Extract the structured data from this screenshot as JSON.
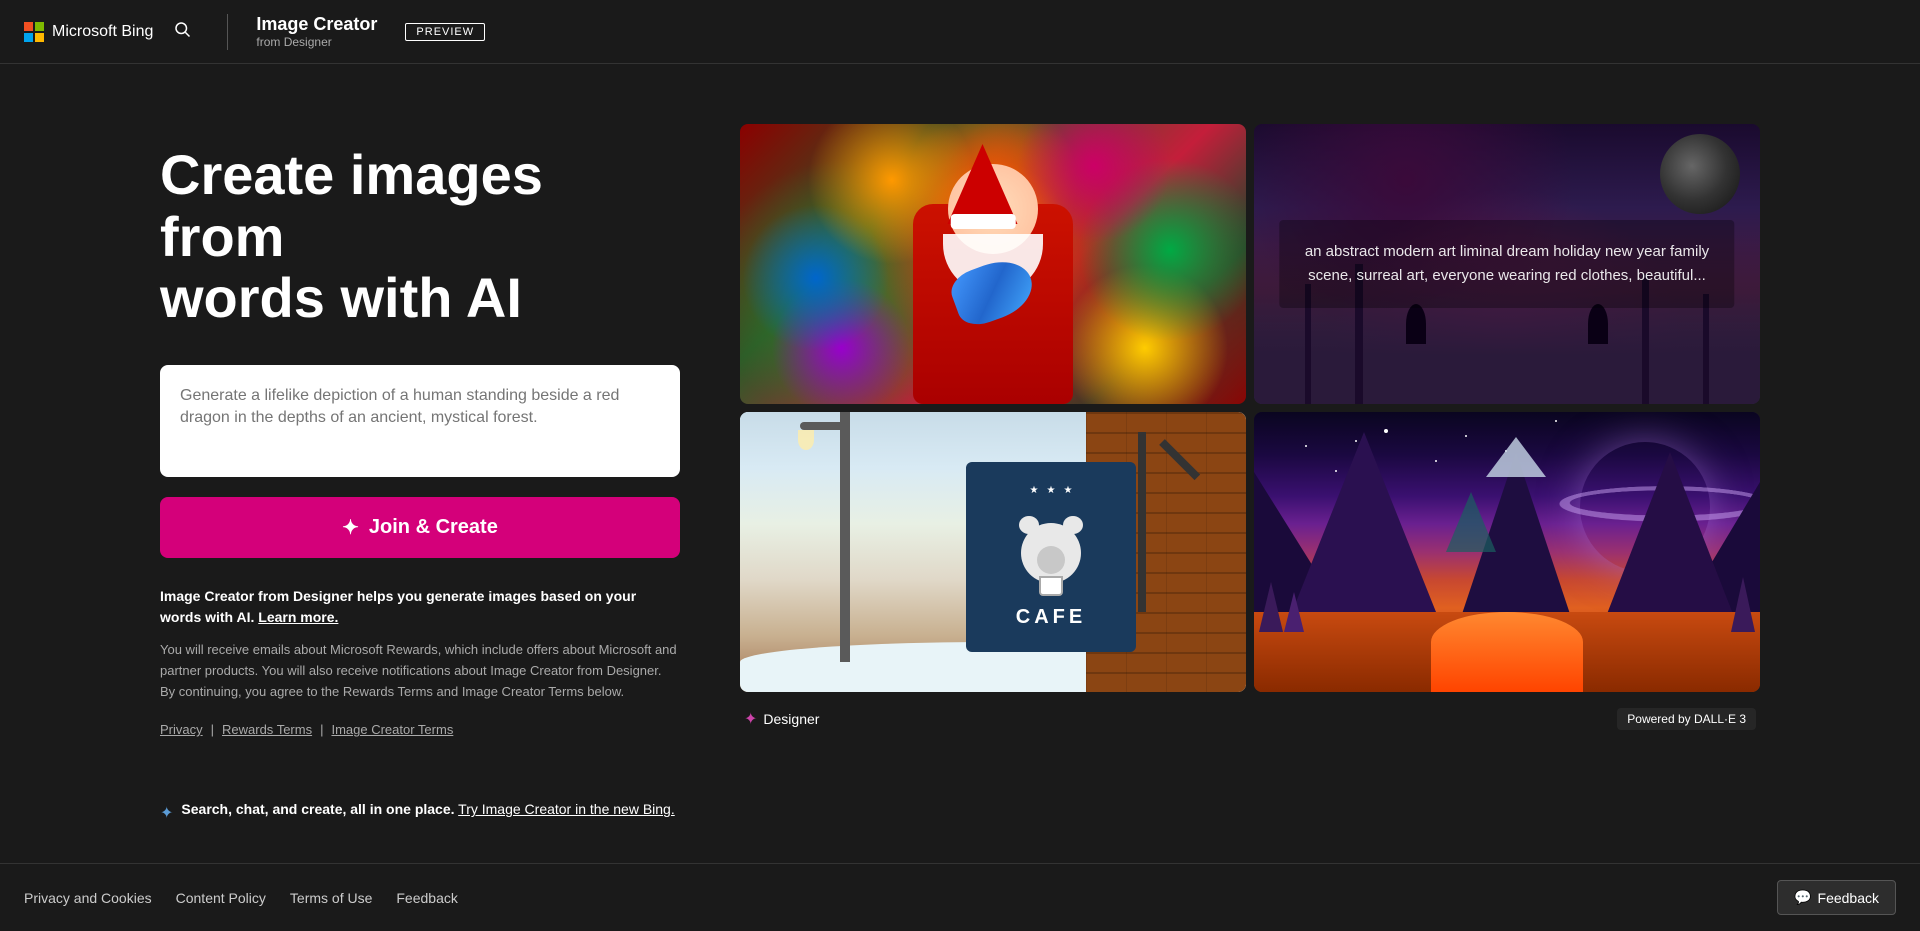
{
  "header": {
    "ms_logo": "⊞",
    "bing_label": "Microsoft Bing",
    "search_icon": "🔍",
    "divider": "|",
    "image_creator_title": "Image Creator",
    "image_creator_subtitle": "from Designer",
    "preview_badge": "PREVIEW"
  },
  "hero": {
    "title_line1": "Create images from",
    "title_line2": "words with AI",
    "prompt_placeholder": "Generate a lifelike depiction of a human standing beside a red dragon in the depths of an ancient, mystical forest.",
    "join_create_btn": "Join & Create"
  },
  "description": {
    "bold_text": "Image Creator from Designer helps you generate images based on your words with AI.",
    "learn_more": "Learn more.",
    "small_text": "You will receive emails about Microsoft Rewards, which include offers about Microsoft and partner products. You will also receive notifications about Image Creator from Designer. By continuing, you agree to the Rewards Terms and Image Creator Terms below.",
    "privacy_link": "Privacy",
    "rewards_terms_link": "Rewards Terms",
    "image_creator_terms_link": "Image Creator Terms"
  },
  "bing_promo": {
    "icon": "✦",
    "line1": "Search, chat, and create, all in one place.",
    "line2": "Try Image Creator in the new Bing."
  },
  "gallery": {
    "image1": {
      "alt": "Santa Claus holding a colorful fish surrounded by ornaments",
      "description": ""
    },
    "image2": {
      "alt": "Abstract modern art liminal dream",
      "description": "an abstract modern art liminal dream holiday new year family scene, surreal art, everyone wearing red clothes, beautiful..."
    },
    "image3": {
      "alt": "Cafe bear sign in snowy setting",
      "description": ""
    },
    "image4": {
      "alt": "Sci-fi fantasy landscape with planet",
      "description": ""
    },
    "designer_label": "Designer",
    "designer_icon": "✦",
    "dalle_badge": "Powered by DALL·E 3"
  },
  "footer": {
    "privacy_cookies": "Privacy and Cookies",
    "content_policy": "Content Policy",
    "terms_of_use": "Terms of Use",
    "feedback": "Feedback",
    "feedback_btn": "Feedback",
    "feedback_icon": "💬"
  },
  "terms_sidebar": {
    "rewards_terms": "Rewards Terms",
    "image_creator_terms": "Image Creator Terms"
  }
}
